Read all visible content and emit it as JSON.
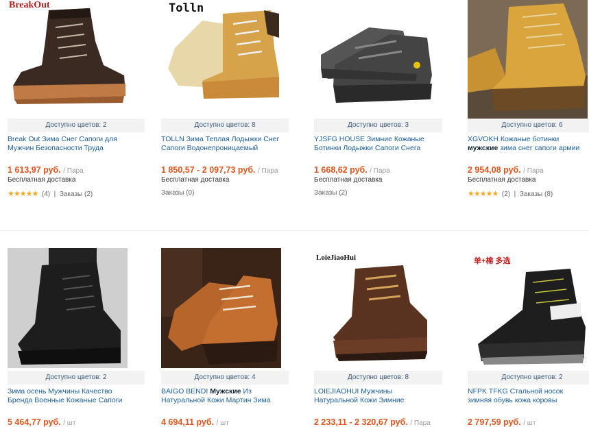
{
  "products": [
    {
      "brand": "BreakOut",
      "colors": "Доступно цветов: 2",
      "title": "Break Out Зима Снег Сапоги для Мужчин Безопасности Труда",
      "price": "1 613,97 руб.",
      "unit": "/ Пара",
      "shipping": "Бесплатная доставка",
      "stars": "★★★★★",
      "reviews": "(4)",
      "orders": "Заказы (2)"
    },
    {
      "brand": "Tolln",
      "colors": "Доступно цветов: 8",
      "title": "TOLLN Зима Теплая Лодыжки Снег Сапоги Водонепроницаемый",
      "price": "1 850,57 - 2 097,73 руб.",
      "unit": "/ Пара",
      "shipping": "Бесплатная доставка",
      "orders": "Заказы (0)"
    },
    {
      "colors": "Доступно цветов: 3",
      "title": "YJSFG HOUSE Зимние Кожаные Ботинки Лодыжки Сапоги Снега",
      "price": "1 668,62 руб.",
      "unit": "/ Пара",
      "shipping": "Бесплатная доставка",
      "orders": "Заказы (2)"
    },
    {
      "colors": "Доступно цветов: 6",
      "title_prefix": "XGVOKH Кожаные ботинки ",
      "title_bold": "мужские",
      "title_suffix": " зима снег сапоги армии",
      "price": "2 954,08 руб.",
      "unit": "/ Пара",
      "shipping": "Бесплатная доставка",
      "stars": "★★★★★",
      "reviews": "(2)",
      "orders": "Заказы (8)"
    },
    {
      "colors": "Доступно цветов: 2",
      "title": "Зима осень Мужчины Качество Бренда Военные Кожаные Сапоги",
      "price": "5 464,77 руб.",
      "unit": "/ шт"
    },
    {
      "colors": "Доступно цветов: 4",
      "title_prefix": "BAIGO BENDI ",
      "title_bold": "Мужские",
      "title_suffix": " Из Натуральной Кожи Мартин Зима",
      "price": "4 694,11 руб.",
      "unit": "/ шт"
    },
    {
      "brand": "LoieJiaoHui",
      "colors": "Доступно цветов: 8",
      "title": "LOIEJIAOHUI Мужчины Натуральной Кожи Зимние",
      "price": "2 233,11 - 2 320,67 руб.",
      "unit": "/ Пара"
    },
    {
      "brand": "单+棉 多选",
      "colors": "Доступно цветов: 2",
      "title": "NFPK TFKG Стальной носок зимняя обувь кожа коровы",
      "price": "2 797,59 руб.",
      "unit": "/ шт"
    }
  ]
}
